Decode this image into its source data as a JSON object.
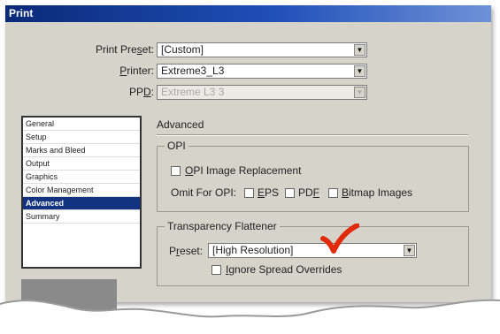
{
  "window": {
    "title": "Print"
  },
  "fields": {
    "print_preset": {
      "label_pre": "Print Pre",
      "label_ul": "s",
      "label_post": "et:",
      "value": "[Custom]"
    },
    "printer": {
      "label_pre": "",
      "label_ul": "P",
      "label_post": "rinter:",
      "value": "Extreme3_L3"
    },
    "ppd": {
      "label_pre": "PP",
      "label_ul": "D",
      "label_post": ":",
      "value": "Extreme L3 3"
    }
  },
  "nav": {
    "items": [
      {
        "label": "General"
      },
      {
        "label": "Setup"
      },
      {
        "label": "Marks and Bleed"
      },
      {
        "label": "Output"
      },
      {
        "label": "Graphics"
      },
      {
        "label": "Color Management"
      },
      {
        "label": "Advanced"
      },
      {
        "label": "Summary"
      }
    ],
    "selected": "Advanced"
  },
  "panel": {
    "title": "Advanced",
    "opi": {
      "group_title": "OPI",
      "replace_pre": "",
      "replace_ul": "O",
      "replace_post": "PI Image Replacement",
      "omit_label": "Omit For OPI:",
      "eps_ul": "E",
      "eps_post": "PS",
      "pdf_pre": "PD",
      "pdf_ul": "F",
      "bitmap_ul": "B",
      "bitmap_post": "itmap Images"
    },
    "flattener": {
      "group_title": "Transparency Flattener",
      "preset_pre": "P",
      "preset_ul": "r",
      "preset_post": "eset:",
      "preset_value": "[High Resolution]",
      "ignore_ul": "I",
      "ignore_post": "gnore Spread Overrides"
    }
  },
  "colors": {
    "title_bar": "#0a2a78",
    "selected_nav": "#123480",
    "check_mark": "#e02a0a",
    "dialog_bg": "#d6d3cb"
  }
}
